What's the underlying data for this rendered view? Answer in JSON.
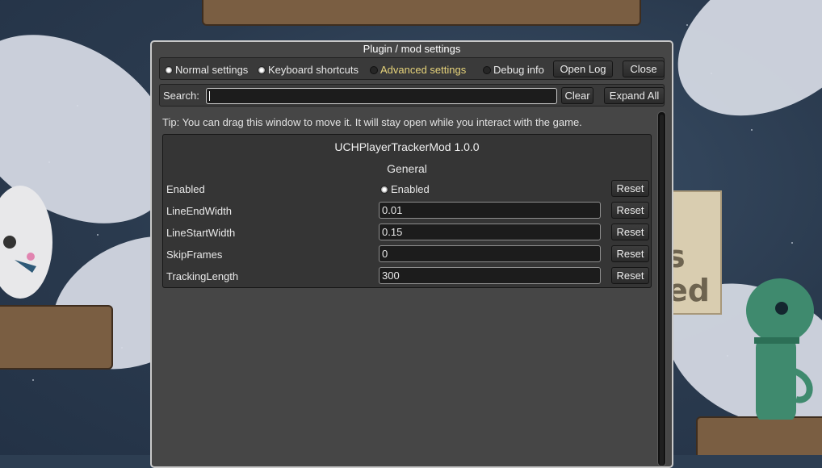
{
  "window": {
    "title": "Plugin / mod settings"
  },
  "tabs": [
    {
      "label": "Normal settings",
      "selected": true
    },
    {
      "label": "Keyboard shortcuts",
      "selected": true
    },
    {
      "label": "Advanced settings",
      "selected": false
    },
    {
      "label": "Debug info",
      "selected": false
    }
  ],
  "buttons": {
    "open_log": "Open Log",
    "close": "Close",
    "clear": "Clear",
    "expand_all": "Expand All"
  },
  "search": {
    "label": "Search:",
    "value": ""
  },
  "tip": "Tip: You can drag this window to move it. It will stay open while you interact with the game.",
  "plugin": {
    "name": "UCHPlayerTrackerMod 1.0.0",
    "section": "General",
    "settings": [
      {
        "label": "Enabled",
        "type": "toggle",
        "value": "Enabled",
        "checked": true,
        "reset": "Reset"
      },
      {
        "label": "LineEndWidth",
        "type": "text",
        "value": "0.01",
        "reset": "Reset"
      },
      {
        "label": "LineStartWidth",
        "type": "text",
        "value": "0.15",
        "reset": "Reset"
      },
      {
        "label": "SkipFrames",
        "type": "text",
        "value": "0",
        "reset": "Reset"
      },
      {
        "label": "TrackingLength",
        "type": "text",
        "value": "300",
        "reset": "Reset"
      }
    ]
  },
  "colors": {
    "window_bg": "#464646",
    "accent_advanced": "#e6d37a"
  }
}
